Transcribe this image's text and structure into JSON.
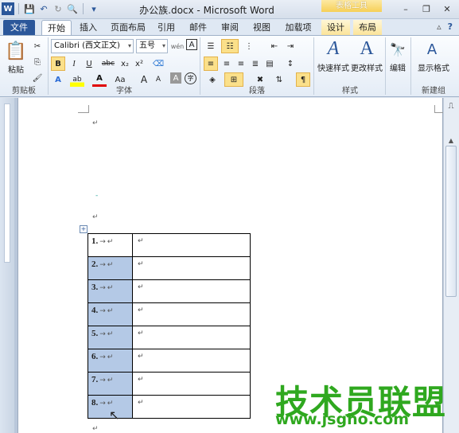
{
  "window": {
    "title": "办公族.docx - Microsoft Word",
    "context_group": "表格工具",
    "icon_glyph": "W",
    "qat": {
      "save_glyph": "💾",
      "undo_glyph": "↶",
      "redo_glyph": "↻",
      "preview_glyph": "🔍",
      "customize_glyph": "▾"
    },
    "controls": {
      "minimize": "–",
      "restore": "❐",
      "close": "✕"
    }
  },
  "tabs": [
    {
      "label": "文件"
    },
    {
      "label": "开始"
    },
    {
      "label": "插入"
    },
    {
      "label": "页面布局"
    },
    {
      "label": "引用"
    },
    {
      "label": "邮件"
    },
    {
      "label": "审阅"
    },
    {
      "label": "视图"
    },
    {
      "label": "加载项"
    },
    {
      "label": "设计"
    },
    {
      "label": "布局"
    }
  ],
  "ribbon_help": {
    "minimize_glyph": "▵",
    "help_glyph": "?"
  },
  "ribbon": {
    "clipboard": {
      "label": "剪贴板",
      "paste": "粘贴",
      "cut_glyph": "✂",
      "copy_glyph": "⎘",
      "painter_glyph": "🖌"
    },
    "font": {
      "label": "字体",
      "font_name": "Calibri (西文正文)",
      "font_size": "五号",
      "bold": "B",
      "italic": "I",
      "underline": "U",
      "strike": "abc",
      "subscript": "x₂",
      "superscript": "x²",
      "grow": "A",
      "shrink": "A",
      "wen": "wén",
      "char_border": "A",
      "effects": "A",
      "highlight": "ab",
      "font_color": "A",
      "case": "Aa",
      "enlarge": "A",
      "shrink2": "A",
      "shading": "A",
      "circle": "字"
    },
    "paragraph": {
      "label": "段落"
    },
    "styles": {
      "label": "样式",
      "quick": "快速样式",
      "change": "更改样式"
    },
    "editing": {
      "label": "编辑",
      "edit": "编辑"
    },
    "new_group": {
      "label": "新建组",
      "show_format": "显示格式"
    }
  },
  "colors": {
    "file_tab": "#2b579a",
    "selection": "#b4c9e6",
    "watermark": "#2fa81f",
    "context": "#f6cf57"
  },
  "document": {
    "para_mark": "↵",
    "table_handle": "+",
    "table_rows": [
      {
        "num": "1.",
        "sel": false
      },
      {
        "num": "2.",
        "sel": true
      },
      {
        "num": "3.",
        "sel": true
      },
      {
        "num": "4.",
        "sel": true
      },
      {
        "num": "5.",
        "sel": true
      },
      {
        "num": "6.",
        "sel": true
      },
      {
        "num": "7.",
        "sel": true
      },
      {
        "num": "8.",
        "sel": true
      }
    ],
    "tab_arrow": "→"
  },
  "watermark": {
    "text": "技术员联盟",
    "url": "www.jsgho.com"
  }
}
